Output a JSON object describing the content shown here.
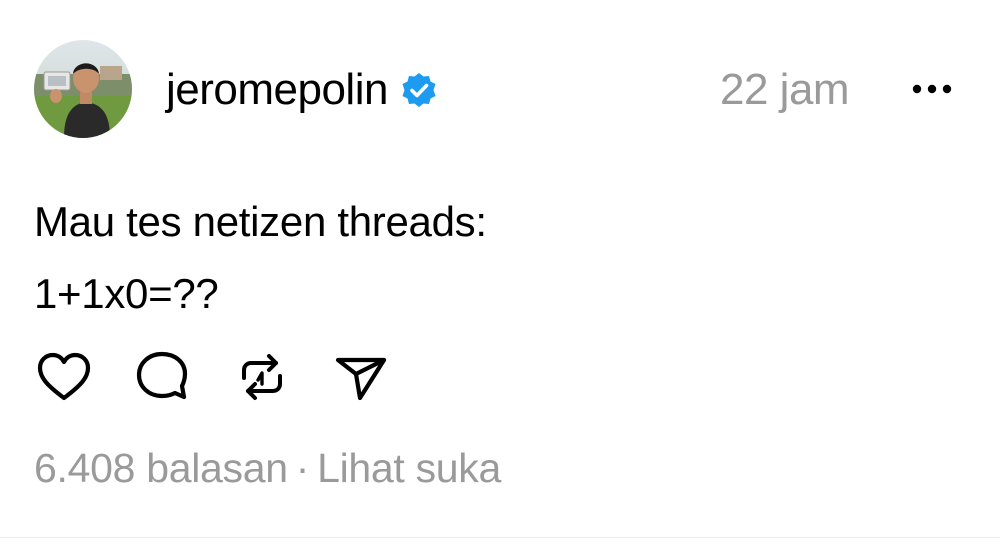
{
  "post": {
    "username": "jeromepolin",
    "verified": true,
    "timestamp": "22 jam",
    "more_icon": "more-horizontal-icon",
    "text_lines": [
      "Mau tes netizen threads:",
      "1+1x0=??"
    ],
    "actions": [
      {
        "name": "like",
        "icon": "heart-icon"
      },
      {
        "name": "reply",
        "icon": "comment-icon"
      },
      {
        "name": "repost",
        "icon": "repost-icon"
      },
      {
        "name": "share",
        "icon": "send-icon"
      }
    ],
    "replies_label": "6.408 balasan",
    "separator": "·",
    "likes_label": "Lihat suka"
  },
  "colors": {
    "text": "#000000",
    "muted": "#9a9a9a",
    "verified_badge": "#1d9bf0"
  }
}
